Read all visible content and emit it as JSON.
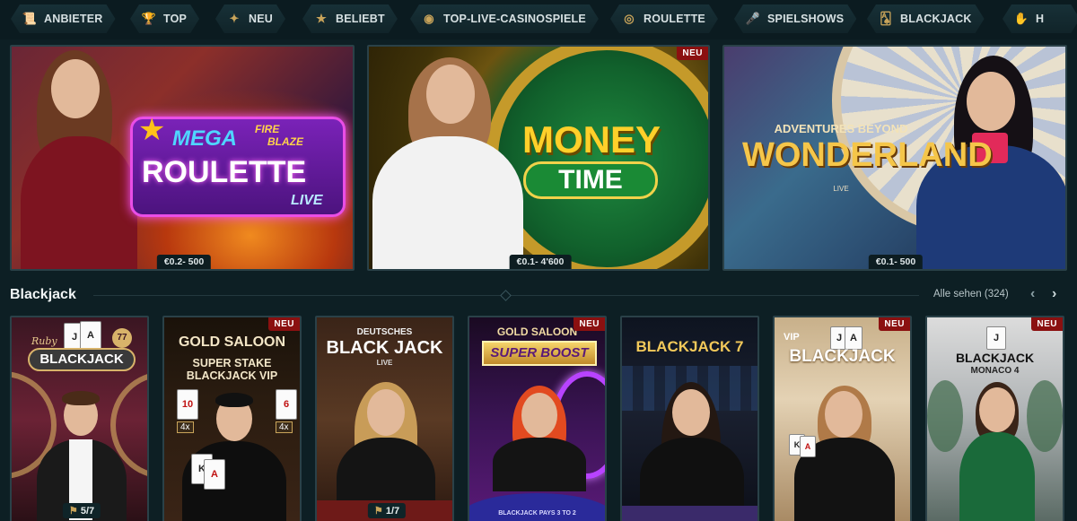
{
  "nav": {
    "items": [
      {
        "label": "ANBIETER",
        "icon": "scroll-icon"
      },
      {
        "label": "TOP",
        "icon": "trophy-icon"
      },
      {
        "label": "NEU",
        "icon": "sparkle-icon"
      },
      {
        "label": "BELIEBT",
        "icon": "star-icon"
      },
      {
        "label": "TOP-LIVE-CASINOSPIELE",
        "icon": "chip-icon"
      },
      {
        "label": "ROULETTE",
        "icon": "roulette-icon"
      },
      {
        "label": "SPIELSHOWS",
        "icon": "microphone-icon"
      },
      {
        "label": "BLACKJACK",
        "icon": "cards-icon"
      },
      {
        "label": "H",
        "icon": "hand-icon"
      }
    ]
  },
  "featured": [
    {
      "title_line1": "MEGA",
      "title_fire": "FIRE",
      "title_blaze": "BLAZE",
      "title_line2": "ROULETTE",
      "title_line3": "LIVE",
      "price": "€0.2- 500",
      "new": false
    },
    {
      "title_line1": "MONEY",
      "title_line2": "TIME",
      "price": "€0.1- 4'600",
      "new": true,
      "new_label": "NEU"
    },
    {
      "title_line1": "ADVENTURES BEYOND",
      "title_line2": "WONDERLAND",
      "title_line3": "LIVE",
      "price": "€0.1- 500",
      "new": false
    }
  ],
  "section": {
    "title": "Blackjack",
    "see_all": "Alle sehen (324)",
    "prev_arrow": "‹",
    "next_arrow": "›"
  },
  "tiles": [
    {
      "title_top": "Ruby",
      "title": "BLACKJACK",
      "badge_num": "77",
      "seats": "5/7",
      "new": false
    },
    {
      "title_top": "GOLD SALOON",
      "title": "SUPER STAKE BLACKJACK VIP",
      "new": true,
      "new_label": "NEU",
      "card_left": "10",
      "card_right": "6",
      "mult": "4x"
    },
    {
      "title_top": "DEUTSCHES",
      "title": "BLACK JACK",
      "title_sub": "LIVE",
      "seats": "1/7",
      "new": false
    },
    {
      "title_top": "GOLD SALOON",
      "title": "SUPER BOOST",
      "table_text": "BLACKJACK PAYS 3 TO 2",
      "new": true,
      "new_label": "NEU"
    },
    {
      "title": "BLACKJACK 7",
      "new": false
    },
    {
      "title_top": "VIP",
      "title": "BLACKJACK",
      "new": true,
      "new_label": "NEU"
    },
    {
      "title": "BLACKJACK",
      "title_sub": "MONACO 4",
      "new": true,
      "new_label": "NEU"
    }
  ]
}
